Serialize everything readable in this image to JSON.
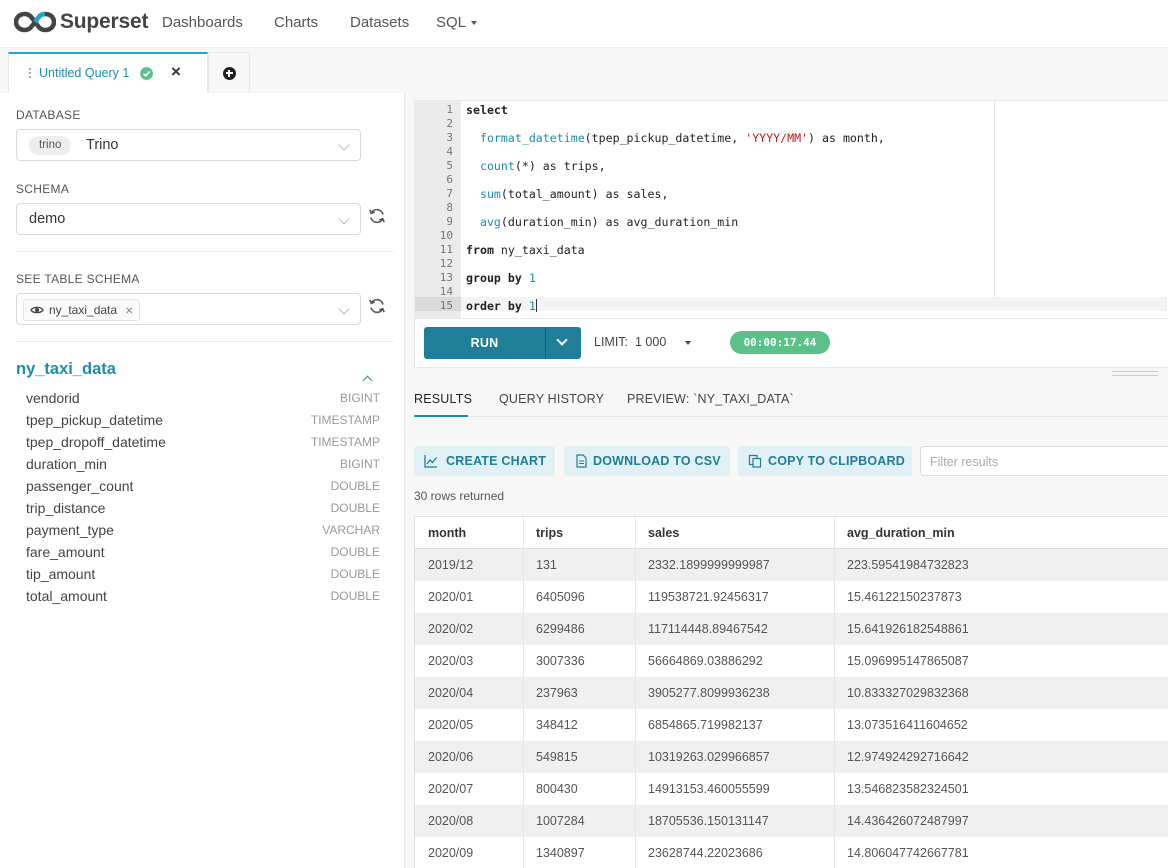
{
  "brand": {
    "name": "Superset"
  },
  "nav": {
    "items": [
      "Dashboards",
      "Charts",
      "Datasets",
      "SQL"
    ]
  },
  "tabs": {
    "active_title": "Untitled Query 1",
    "close_glyph": "×"
  },
  "left": {
    "database_label": "DATABASE",
    "database_tag": "trino",
    "database_name": "Trino",
    "schema_label": "SCHEMA",
    "schema_value": "demo",
    "table_schema_label": "SEE TABLE SCHEMA",
    "table_tag": "ny_taxi_data",
    "table_tag_remove": "×",
    "table_title": "ny_taxi_data",
    "columns": [
      {
        "name": "vendorid",
        "type": "BIGINT"
      },
      {
        "name": "tpep_pickup_datetime",
        "type": "TIMESTAMP"
      },
      {
        "name": "tpep_dropoff_datetime",
        "type": "TIMESTAMP"
      },
      {
        "name": "duration_min",
        "type": "BIGINT"
      },
      {
        "name": "passenger_count",
        "type": "DOUBLE"
      },
      {
        "name": "trip_distance",
        "type": "DOUBLE"
      },
      {
        "name": "payment_type",
        "type": "VARCHAR"
      },
      {
        "name": "fare_amount",
        "type": "DOUBLE"
      },
      {
        "name": "tip_amount",
        "type": "DOUBLE"
      },
      {
        "name": "total_amount",
        "type": "DOUBLE"
      }
    ]
  },
  "editor": {
    "line_numbers": [
      "1",
      "2",
      "3",
      "4",
      "5",
      "6",
      "7",
      "8",
      "9",
      "10",
      "11",
      "12",
      "13",
      "14",
      "15"
    ],
    "code": {
      "select": "select",
      "l3_fn": "format_datetime",
      "l3_a": "(tpep_pickup_datetime, ",
      "l3_str": "'YYYY/MM'",
      "l3_b": ") as month,",
      "l5_fn": "count",
      "l5_rest": "(*) as trips,",
      "l7_fn": "sum",
      "l7_rest": "(total_amount) as sales,",
      "l9_fn": "avg",
      "l9_rest": "(duration_min) as avg_duration_min",
      "l11_kw": "from",
      "l11_rest": " ny_taxi_data",
      "l13_kw": "group by",
      "l13_num": "1",
      "l15_kw": "order by",
      "l15_num": "1"
    }
  },
  "controls": {
    "run_label": "RUN",
    "limit_label": "LIMIT:",
    "limit_value": "1 000",
    "timer": "00:00:17.44"
  },
  "results": {
    "tabs": [
      "RESULTS",
      "QUERY HISTORY",
      "PREVIEW: `NY_TAXI_DATA`"
    ],
    "actions": [
      "CREATE CHART",
      "DOWNLOAD TO CSV",
      "COPY TO CLIPBOARD"
    ],
    "filter_placeholder": "Filter results",
    "rows_returned": "30 rows returned",
    "columns": [
      "month",
      "trips",
      "sales",
      "avg_duration_min"
    ],
    "rows": [
      [
        "2019/12",
        "131",
        "2332.1899999999987",
        "223.59541984732823"
      ],
      [
        "2020/01",
        "6405096",
        "119538721.92456317",
        "15.46122150237873"
      ],
      [
        "2020/02",
        "6299486",
        "117114448.89467542",
        "15.641926182548861"
      ],
      [
        "2020/03",
        "3007336",
        "56664869.03886292",
        "15.096995147865087"
      ],
      [
        "2020/04",
        "237963",
        "3905277.8099936238",
        "10.833327029832368"
      ],
      [
        "2020/05",
        "348412",
        "6854865.719982137",
        "13.073516411604652"
      ],
      [
        "2020/06",
        "549815",
        "10319263.029966857",
        "12.974924292716642"
      ],
      [
        "2020/07",
        "800430",
        "14913153.460055599",
        "13.546823582324501"
      ],
      [
        "2020/08",
        "1007284",
        "18705536.150131147",
        "14.436426072487997"
      ],
      [
        "2020/09",
        "1340897",
        "23628744.22023686",
        "14.806047742667781"
      ]
    ]
  }
}
